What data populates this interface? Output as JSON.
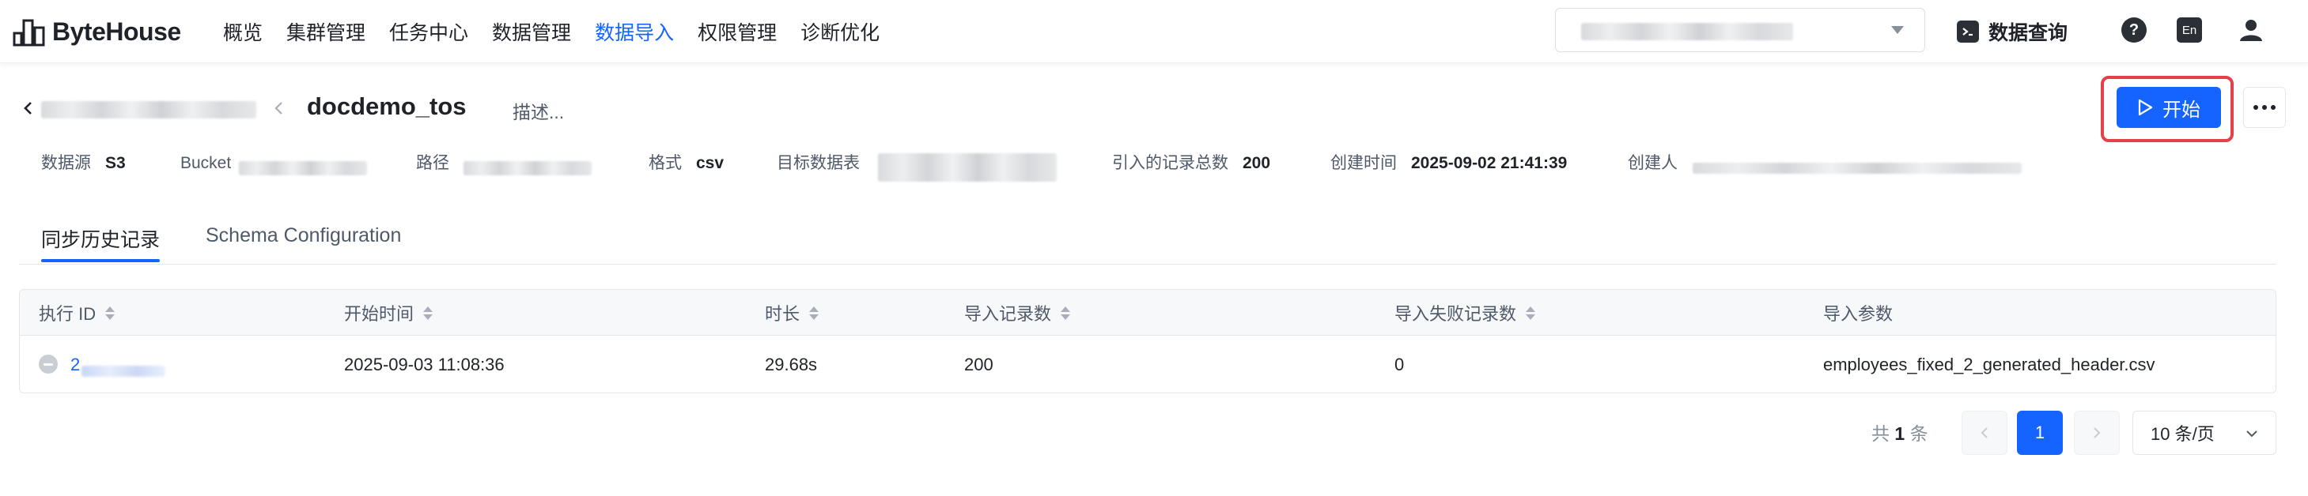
{
  "app": {
    "name": "ByteHouse"
  },
  "nav": {
    "items": [
      "概览",
      "集群管理",
      "任务中心",
      "数据管理",
      "数据导入",
      "权限管理",
      "诊断优化"
    ],
    "active_index": 4
  },
  "topbar": {
    "query_label": "数据查询",
    "help_label": "?",
    "lang_label": "En"
  },
  "task": {
    "title": "docdemo_tos",
    "desc_placeholder": "描述...",
    "start_label": "开始"
  },
  "meta": {
    "datasource_label": "数据源",
    "datasource_value": "S3",
    "bucket_label": "Bucket",
    "path_label": "路径",
    "format_label": "格式",
    "format_value": "csv",
    "target_label": "目标数据表",
    "records_label": "引入的记录总数",
    "records_value": "200",
    "created_label": "创建时间",
    "created_value": "2025-09-02 21:41:39",
    "creator_label": "创建人"
  },
  "tabs": [
    "同步历史记录",
    "Schema Configuration"
  ],
  "table": {
    "columns": [
      "执行 ID",
      "开始时间",
      "时长",
      "导入记录数",
      "导入失败记录数",
      "导入参数"
    ],
    "rows": [
      {
        "exec_id": "2",
        "start_time": "2025-09-03 11:08:36",
        "duration": "29.68s",
        "imported": "200",
        "failed": "0",
        "params": "employees_fixed_2_generated_header.csv"
      }
    ]
  },
  "pagination": {
    "total_prefix": "共",
    "total_count": "1",
    "total_suffix": "条",
    "current_page": "1",
    "page_size": "10 条/页"
  },
  "colors": {
    "primary": "#1664ff",
    "highlight_border": "#e5404a",
    "text": "#1f2329",
    "muted": "#4e5969"
  }
}
